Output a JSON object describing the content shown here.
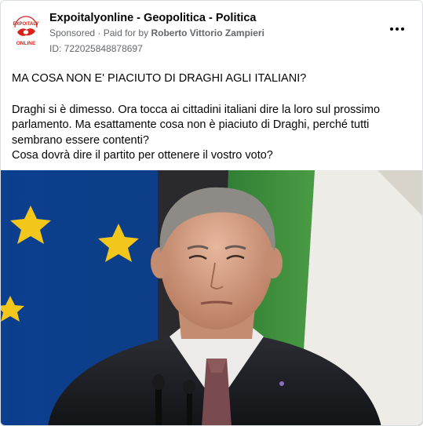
{
  "post": {
    "page_name": "Expoitalyonline - Geopolitica - Politica",
    "sponsored": "Sponsored",
    "paid_for_prefix": "Paid for by",
    "payer": "Roberto Vittorio Zampieri",
    "ad_id": "ID: 722025848878697",
    "avatar": {
      "logo_text_top": "EXPOITALY",
      "logo_text_bottom": "ONLINE",
      "icon": "expoitaly-logo-icon"
    },
    "more_icon": "more-options-icon",
    "headline": "MA COSA NON E' PIACIUTO DI DRAGHI AGLI ITALIANI?",
    "body_lines": [
      "Draghi si è dimesso. Ora tocca ai cittadini italiani dire la loro sul prossimo parlamento. Ma esattamente cosa non è piaciuto di Draghi, perché tutti sembrano essere contenti?",
      "Cosa dovrà dire il partito per ottenere il vostro voto?"
    ],
    "image": {
      "description_icon": "portrait-photo-icon"
    }
  },
  "colors": {
    "eu_blue": "#0b3f8f",
    "eu_star": "#f2c61b",
    "flag_green": "#3a8a3c",
    "flag_white": "#f1efea",
    "logo_red": "#d9211c"
  }
}
